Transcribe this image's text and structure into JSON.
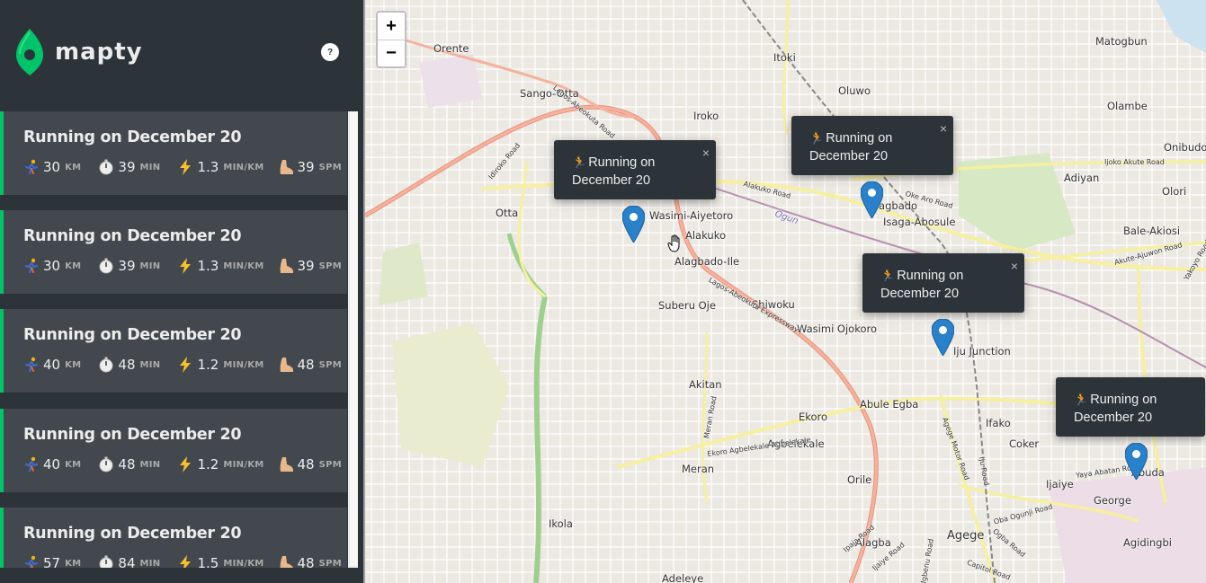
{
  "app": {
    "name": "mapty",
    "help_label": "?"
  },
  "workouts": [
    {
      "title": "Running on December 20",
      "distance": "30",
      "distance_unit": "KM",
      "duration": "39",
      "duration_unit": "MIN",
      "pace": "1.3",
      "pace_unit": "MIN/KM",
      "cadence": "39",
      "cadence_unit": "SPM"
    },
    {
      "title": "Running on December 20",
      "distance": "30",
      "distance_unit": "KM",
      "duration": "39",
      "duration_unit": "MIN",
      "pace": "1.3",
      "pace_unit": "MIN/KM",
      "cadence": "39",
      "cadence_unit": "SPM"
    },
    {
      "title": "Running on December 20",
      "distance": "40",
      "distance_unit": "KM",
      "duration": "48",
      "duration_unit": "MIN",
      "pace": "1.2",
      "pace_unit": "MIN/KM",
      "cadence": "48",
      "cadence_unit": "SPM"
    },
    {
      "title": "Running on December 20",
      "distance": "40",
      "distance_unit": "KM",
      "duration": "48",
      "duration_unit": "MIN",
      "pace": "1.2",
      "pace_unit": "MIN/KM",
      "cadence": "48",
      "cadence_unit": "SPM"
    },
    {
      "title": "Running on December 20",
      "distance": "57",
      "distance_unit": "KM",
      "duration": "84",
      "duration_unit": "MIN",
      "pace": "1.5",
      "pace_unit": "MIN/KM",
      "cadence": "48",
      "cadence_unit": "SPM"
    }
  ],
  "map": {
    "zoom_in": "+",
    "zoom_out": "−",
    "popups": [
      {
        "line1": "Running on",
        "line2": "December 20",
        "close": "×"
      },
      {
        "line1": "Running on",
        "line2": "December 20",
        "close": "×"
      },
      {
        "line1": "Running on",
        "line2": "December 20",
        "close": "×"
      },
      {
        "line1": "Running on",
        "line2": "December 20",
        "close": ""
      }
    ],
    "places": [
      "Orente",
      "Sango-Otta",
      "Iroko",
      "Itoki",
      "Oluwo",
      "Matogbun",
      "Olambe",
      "Onibudo",
      "Adiyan",
      "Olori",
      "Otta",
      "Wasimi-Aiyetoro",
      "Alakuko",
      "Alagbado-Ile",
      "Alagbado",
      "Isaga-Abosule",
      "Bale-Akiosi",
      "Suberu Oje",
      "Shiwoku",
      "Wasimi Ojokoro",
      "Iju Junction",
      "Akitan",
      "Ekoro",
      "Abule Egba",
      "Agbelekale",
      "Meran",
      "Ifako",
      "Coker",
      "Ijaiye",
      "George",
      "Orile",
      "Ikola",
      "Alagba",
      "Agege",
      "Agidingbi",
      "Adeleye",
      "Abuda"
    ],
    "roads": [
      "Lagos-Abeokuta Road",
      "Idiroko Road",
      "Alakuko Road",
      "Oke Aro Road",
      "Ijoko Akute Road",
      "Akute-Ajuwon Road",
      "Yakoyo Road",
      "Lagos-Abeokuta Expressway",
      "Ekoro Agbelekale Agbelekale",
      "Meran Road",
      "Agege Motor Road",
      "Ijaiye Road",
      "Yaya Abatan Road",
      "Oba Ogunji Road",
      "Ogba Road",
      "Capitol Road",
      "Ipaja Road",
      "Igbenu Road",
      "Iju Road",
      "Ogun"
    ]
  },
  "colors": {
    "sidebar_bg": "#2d3439",
    "card_bg": "#42484d",
    "running_accent": "#00c46a",
    "popup_bg": "#2d3439",
    "marker": "#2a81cb"
  },
  "icons": {
    "distance": "runner-icon",
    "duration": "stopwatch-icon",
    "pace": "lightning-icon",
    "cadence": "foot-icon"
  }
}
